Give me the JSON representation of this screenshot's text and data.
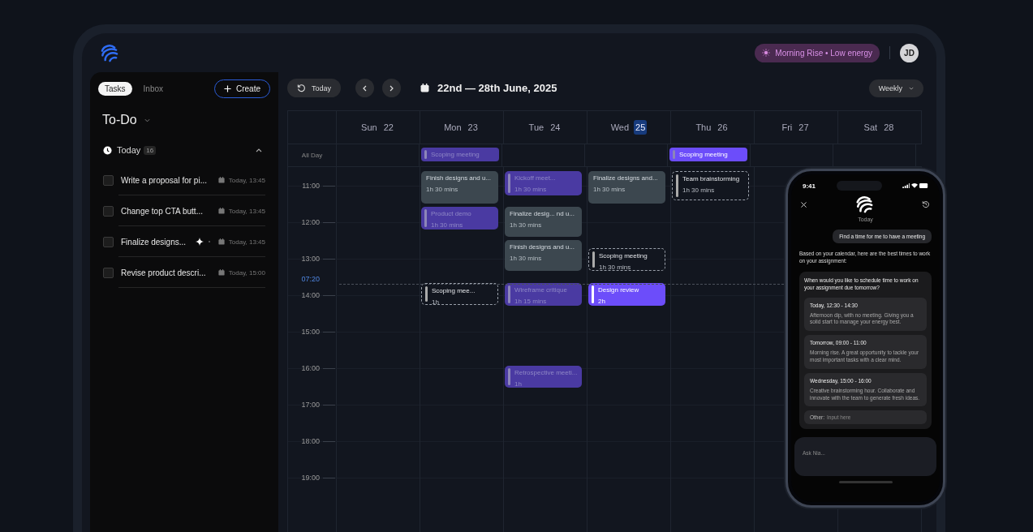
{
  "topbar": {
    "energy": "Morning Rise • Low energy",
    "avatar": "JD"
  },
  "sidebar": {
    "tabs": [
      {
        "label": "Tasks",
        "selected": true
      },
      {
        "label": "Inbox",
        "selected": false
      }
    ],
    "create": "Create",
    "list_title": "To-Do",
    "section": {
      "label": "Today",
      "count": "16",
      "expanded": true
    },
    "tasks": [
      {
        "title": "Write a proposal for pi...",
        "due": "Today, 13:45",
        "checked": false,
        "sparkle": false
      },
      {
        "title": "Change top CTA butt...",
        "due": "Today, 13:45",
        "checked": false,
        "sparkle": false
      },
      {
        "title": "Finalize designs...",
        "due": "Today, 13:45",
        "checked": false,
        "sparkle": true
      },
      {
        "title": "Revise product descri...",
        "due": "Today, 15:00",
        "checked": false,
        "sparkle": false
      }
    ]
  },
  "toolbar": {
    "today": "Today",
    "range": "22nd — 28th June, 2025",
    "view": "Weekly"
  },
  "calendar": {
    "all_day_label": "All Day",
    "hours": [
      "11:00",
      "12:00",
      "13:00",
      "14:00",
      "15:00",
      "16:00",
      "17:00",
      "18:00",
      "19:00"
    ],
    "now": {
      "label": "07:20"
    },
    "days": [
      {
        "weekday": "Sun",
        "date": "22",
        "selected": false
      },
      {
        "weekday": "Mon",
        "date": "23",
        "selected": false,
        "all_day": [
          {
            "title": "Scoping meeting",
            "kind": "purple"
          }
        ],
        "events": [
          {
            "title": "Finish designs and u...",
            "duration": "1h 30 mins",
            "kind": "grey"
          },
          {
            "title": "Product demo",
            "duration": "1h 30 mins",
            "kind": "purple"
          },
          {
            "title": "Scoping mee...",
            "duration": "1h",
            "kind": "tentative"
          }
        ]
      },
      {
        "weekday": "Tue",
        "date": "24",
        "selected": false,
        "events": [
          {
            "title": "Kickoff meet...",
            "duration": "1h 30 mins",
            "kind": "purple"
          },
          {
            "title": "Finalize desig... nd u...",
            "duration": "1h 30 mins",
            "kind": "grey"
          },
          {
            "title": "Finish designs and u...",
            "duration": "1h 30 mins",
            "kind": "grey"
          },
          {
            "title": "Wireframe critique",
            "duration": "1h 15 mins",
            "kind": "purple"
          },
          {
            "title": "Retrospective meeti...",
            "duration": "1h",
            "kind": "purple"
          }
        ]
      },
      {
        "weekday": "Wed",
        "date": "25",
        "selected": true,
        "events": [
          {
            "title": "Finalize designs and...",
            "duration": "1h 30 mins",
            "kind": "grey"
          },
          {
            "title": "Scoping meeting",
            "duration": "1h 30 mins",
            "kind": "tentative"
          },
          {
            "title": "Design review",
            "duration": "2h",
            "kind": "highlight"
          }
        ]
      },
      {
        "weekday": "Thu",
        "date": "26",
        "selected": false,
        "all_day": [
          {
            "title": "Scoping meeting",
            "kind": "highlight"
          }
        ],
        "events": [
          {
            "title": "Team brainstorming",
            "duration": "1h 30 mins",
            "kind": "tentative"
          }
        ]
      },
      {
        "weekday": "Fri",
        "date": "27",
        "selected": false
      },
      {
        "weekday": "Sat",
        "date": "28",
        "selected": false
      }
    ]
  },
  "assistant": {
    "time": "9:41",
    "title": "Today",
    "user_message": "Find a time for me to have a meeting",
    "reply": "Based on your calendar, here are the best times to work on your assignment:",
    "question": "When would you like to schedule time to work on your assignment due tomorrow?",
    "options": [
      {
        "time": "Today, 12:30 - 14:30",
        "note": "Afternoon dip, with no meeting. Giving you a solid start to manage your energy best."
      },
      {
        "time": "Tomorrow, 09:00 - 11:00",
        "note": "Morning rise. A great opportunity to tackle your most important tasks with a clear mind."
      },
      {
        "time": "Wednesday, 15:00 - 16:00",
        "note": "Creative brainstorming hour. Collaborate and innovate with the team to generate fresh ideas."
      }
    ],
    "other_label": "Other:",
    "other_placeholder": "Input here",
    "input_placeholder": "Ask Nia..."
  }
}
